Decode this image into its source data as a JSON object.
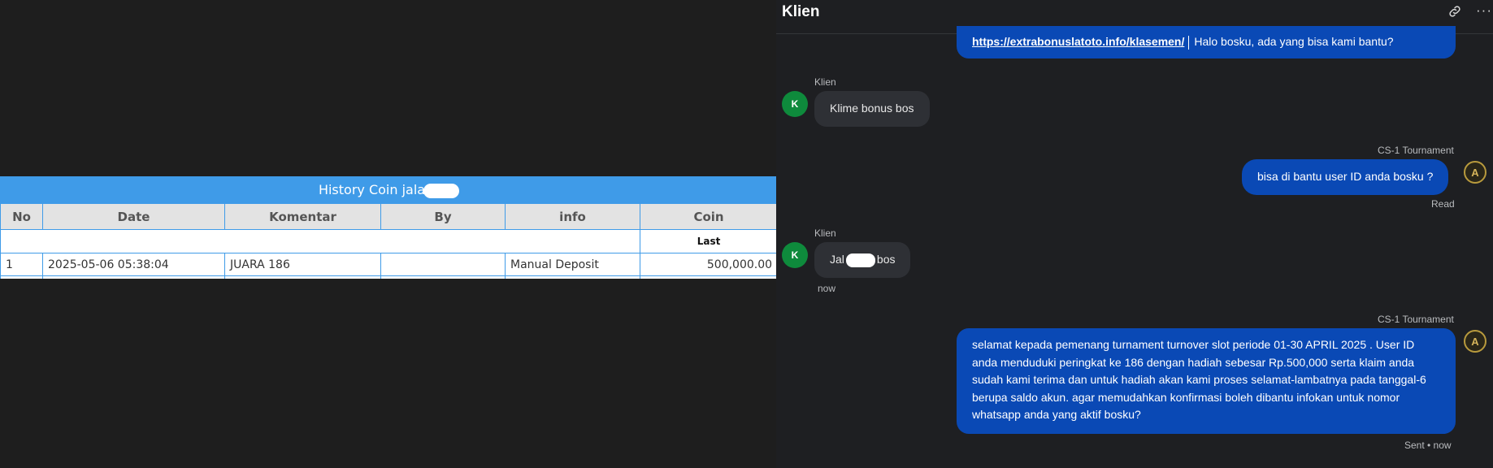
{
  "history": {
    "title": "History Coin jala",
    "columns": [
      "No",
      "Date",
      "Komentar",
      "By",
      "info",
      "Coin"
    ],
    "sub_label": "Last",
    "rows": [
      {
        "no": "1",
        "date": "2025-05-06 05:38:04",
        "komentar": "JUARA 186",
        "by": "",
        "info": "Manual Deposit",
        "coin": "500,000.00"
      }
    ]
  },
  "chat": {
    "title": "Klien",
    "messages": {
      "m1": {
        "link": "https://extrabonuslatoto.info/klasemen/",
        "text": "Halo bosku, ada yang bisa kami bantu?"
      },
      "m2": {
        "sender": "Klien",
        "avatar": "K",
        "text": "Klime bonus bos"
      },
      "m3": {
        "sender": "CS-1 Tournament",
        "avatar": "A",
        "text": "bisa di bantu user ID anda bosku ?",
        "status": "Read"
      },
      "m4": {
        "sender": "Klien",
        "avatar": "K",
        "text_before": "Jal",
        "text_after": "bos",
        "time": "now"
      },
      "m5": {
        "sender": "CS-1 Tournament",
        "avatar": "A",
        "text": "selamat kepada pemenang turnament turnover slot periode 01-30 APRIL 2025 . User ID anda menduduki peringkat ke 186 dengan hadiah sebesar Rp.500,000 serta klaim anda sudah kami terima dan untuk hadiah akan kami proses selamat-lambatnya pada tanggal-6 berupa saldo akun. agar memudahkan konfirmasi boleh dibantu infokan untuk nomor whatsapp anda yang aktif bosku?",
        "status": "Sent • now"
      }
    }
  },
  "icons": {
    "link": "link-icon",
    "more": "more-icon"
  },
  "colors": {
    "table_header": "#3f9be8",
    "coin_value": "#3c9d2f",
    "outgoing_bubble": "#0a49b5",
    "incoming_bubble": "#2e3035",
    "client_avatar": "#0e8a3c"
  }
}
